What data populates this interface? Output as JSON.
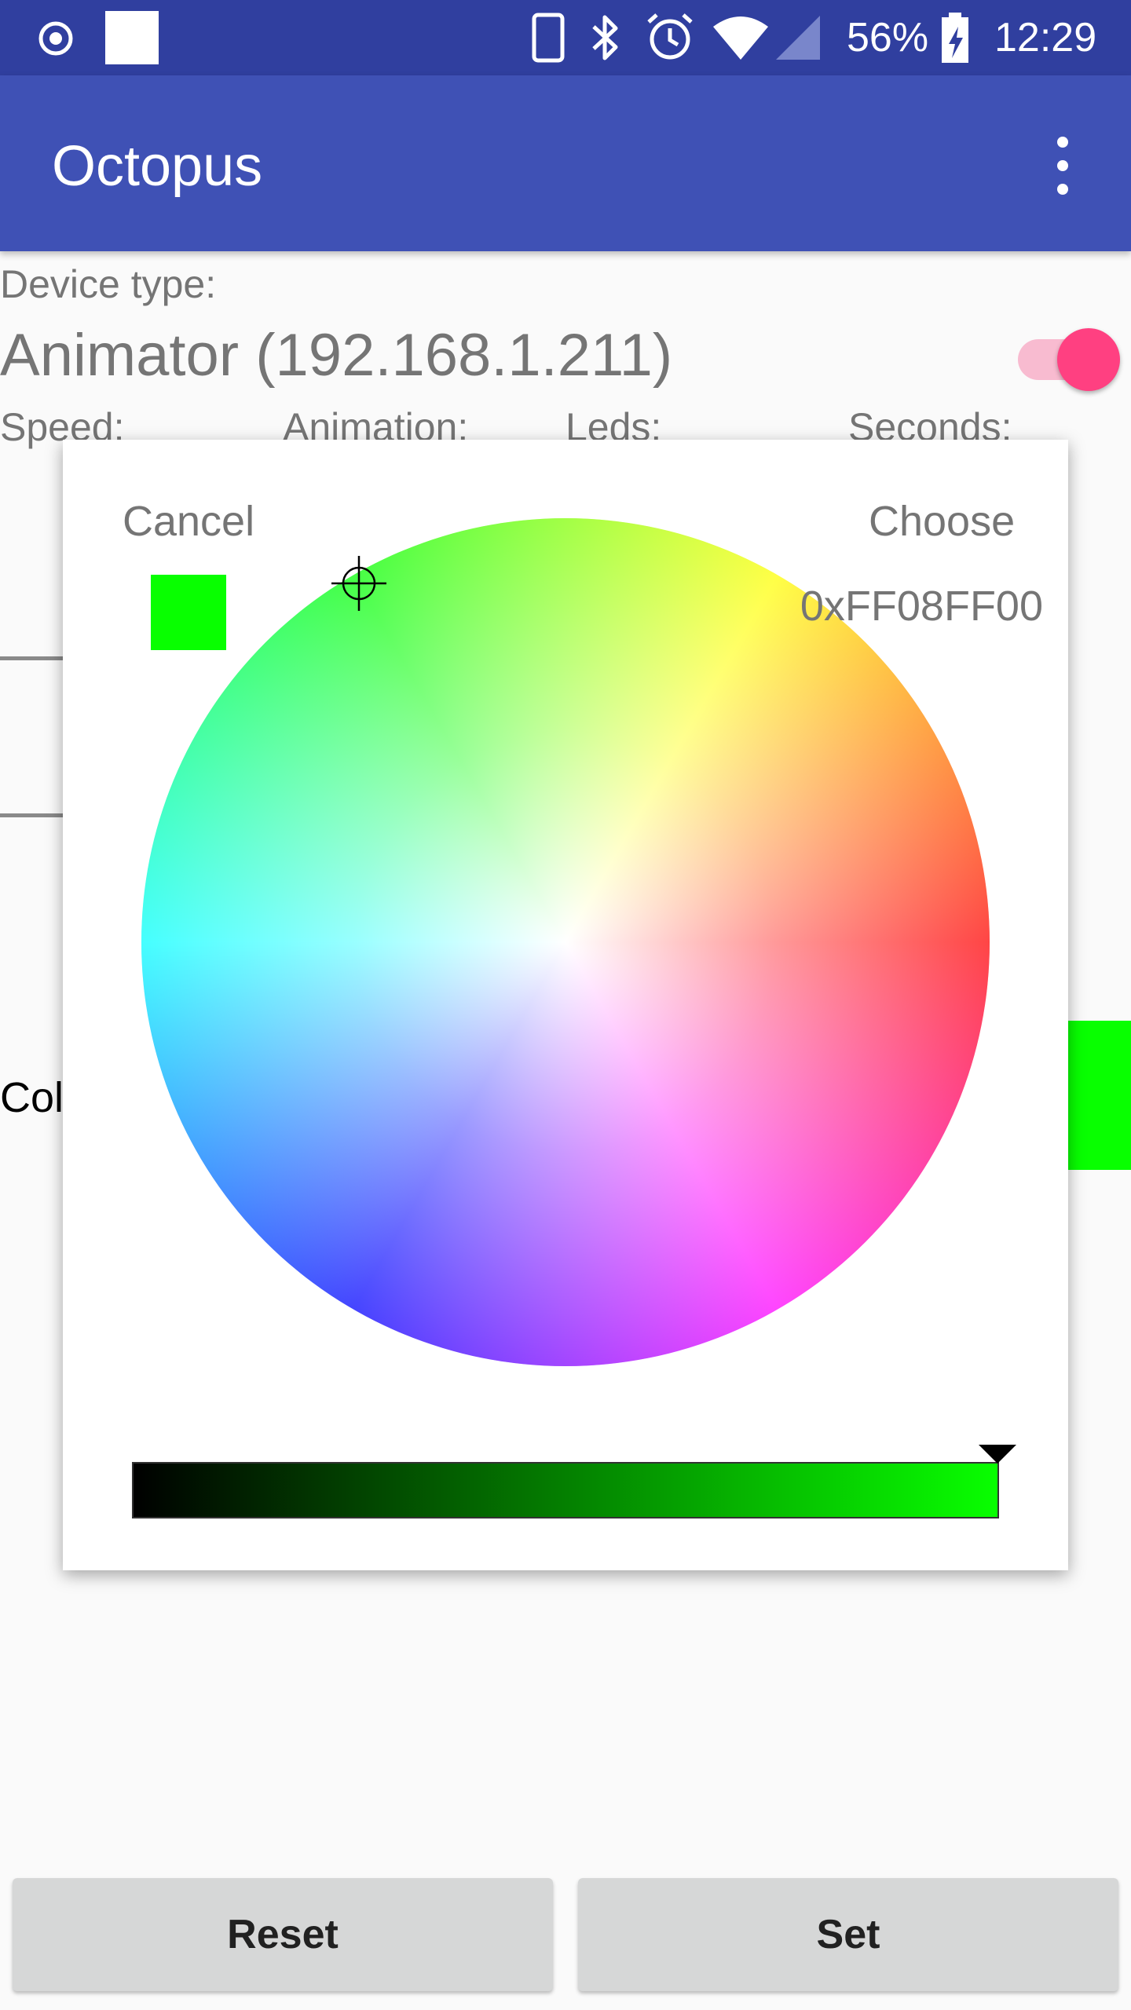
{
  "status_bar": {
    "battery_percent": "56%",
    "time": "12:29",
    "icons": [
      "record-icon",
      "notification-square-icon",
      "phone-icon",
      "bluetooth-icon",
      "alarm-icon",
      "wifi-icon",
      "signal-icon",
      "battery-charging-icon"
    ]
  },
  "app_bar": {
    "title": "Octopus",
    "menu_icon": "more-vert-icon"
  },
  "device": {
    "type_label": "Device type:",
    "name": "Animator (192.168.1.211)",
    "enabled": true
  },
  "params": {
    "speed_label": "Speed:",
    "animation_label": "Animation:",
    "leds_label": "Leds:",
    "seconds_label": "Seconds:"
  },
  "color_row": {
    "label": "Col",
    "color": "#08FF00"
  },
  "color_dialog": {
    "cancel_label": "Cancel",
    "choose_label": "Choose",
    "hex_value": "0xFF08FF00",
    "selected_color": "#08FF00",
    "brightness": 1.0
  },
  "buttons": {
    "reset_label": "Reset",
    "set_label": "Set"
  }
}
